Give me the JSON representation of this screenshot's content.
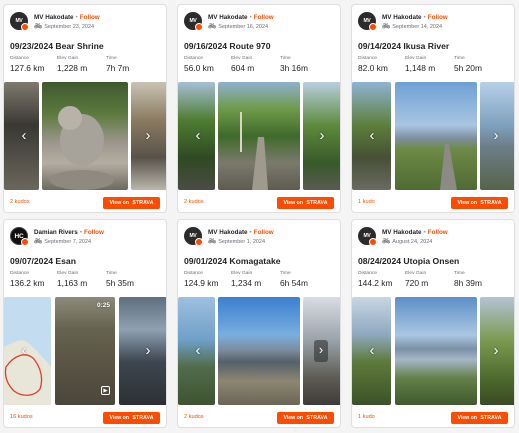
{
  "activities": [
    {
      "athlete": "MV Hakodate",
      "avatar_text": "MV",
      "follow_label": "Follow",
      "date": "September 23, 2024",
      "title": "09/23/2024 Bear Shrine",
      "stats": [
        {
          "label": "Distance",
          "value": "127.6 km"
        },
        {
          "label": "Elev Gain",
          "value": "1,228 m"
        },
        {
          "label": "Time",
          "value": "7h 7m"
        }
      ],
      "kudos": "2 kudos",
      "button_prefix": "View on",
      "button_brand": "STRAVA"
    },
    {
      "athlete": "MV Hakodate",
      "avatar_text": "MV",
      "follow_label": "Follow",
      "date": "September 16, 2024",
      "title": "09/16/2024 Route 970",
      "stats": [
        {
          "label": "Distance",
          "value": "56.0 km"
        },
        {
          "label": "Elev Gain",
          "value": "604 m"
        },
        {
          "label": "Time",
          "value": "3h 16m"
        }
      ],
      "kudos": "2 kudos",
      "button_prefix": "View on",
      "button_brand": "STRAVA"
    },
    {
      "athlete": "MV Hakodate",
      "avatar_text": "MV",
      "follow_label": "Follow",
      "date": "September 14, 2024",
      "title": "09/14/2024 Ikusa River",
      "stats": [
        {
          "label": "Distance",
          "value": "82.0 km"
        },
        {
          "label": "Elev Gain",
          "value": "1,148 m"
        },
        {
          "label": "Time",
          "value": "5h 20m"
        }
      ],
      "kudos": "1 kudo",
      "button_prefix": "View on",
      "button_brand": "STRAVA"
    },
    {
      "athlete": "Damian Rivers",
      "avatar_text": "HC",
      "follow_label": "Follow",
      "date": "September 7, 2024",
      "title": "09/07/2024 Esan",
      "stats": [
        {
          "label": "Distance",
          "value": "136.2 km"
        },
        {
          "label": "Elev Gain",
          "value": "1,163 m"
        },
        {
          "label": "Time",
          "value": "5h 35m"
        }
      ],
      "video_duration": "0:25",
      "kudos": "16 kudos",
      "button_prefix": "View on",
      "button_brand": "STRAVA"
    },
    {
      "athlete": "MV Hakodate",
      "avatar_text": "MV",
      "follow_label": "Follow",
      "date": "September 1, 2024",
      "title": "09/01/2024 Komagatake",
      "stats": [
        {
          "label": "Distance",
          "value": "124.9 km"
        },
        {
          "label": "Elev Gain",
          "value": "1,234 m"
        },
        {
          "label": "Time",
          "value": "6h 54m"
        }
      ],
      "kudos": "2 kudos",
      "button_prefix": "View on",
      "button_brand": "STRAVA"
    },
    {
      "athlete": "MV Hakodate",
      "avatar_text": "MV",
      "follow_label": "Follow",
      "date": "August 24, 2024",
      "title": "08/24/2024 Utopia Onsen",
      "stats": [
        {
          "label": "Distance",
          "value": "144.2 km"
        },
        {
          "label": "Elev Gain",
          "value": "720 m"
        },
        {
          "label": "Time",
          "value": "8h 39m"
        }
      ],
      "kudos": "1 kudo",
      "button_prefix": "View on",
      "button_brand": "STRAVA"
    }
  ],
  "icons": {
    "strava_badge": "strava-logo-icon",
    "bike": "bike-icon",
    "carousel_prev": "chevron-left-icon",
    "carousel_next": "chevron-right-icon",
    "video": "video-icon"
  },
  "colors": {
    "accent": "#fc4c02",
    "text": "#242428",
    "muted": "#6d6d78"
  }
}
